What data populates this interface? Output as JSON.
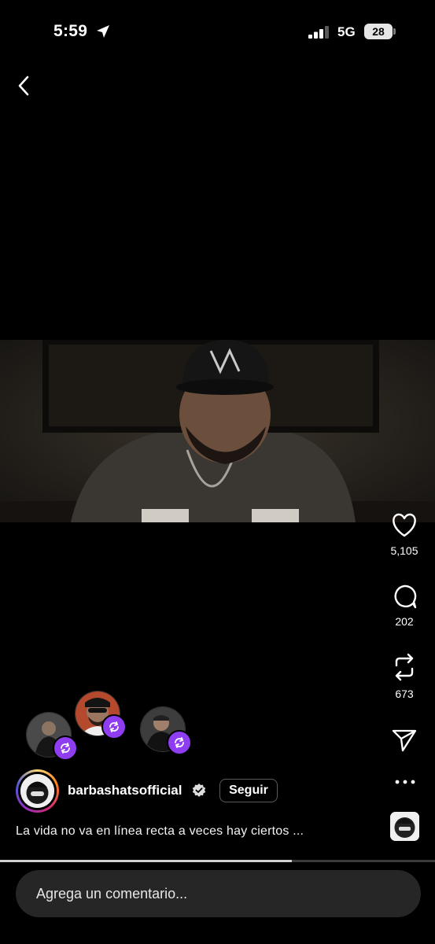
{
  "status_bar": {
    "time": "5:59",
    "network": "5G",
    "battery": "28"
  },
  "icons": {
    "back": "chevron-left-icon",
    "like": "heart-icon",
    "comment": "comment-bubble-icon",
    "repost": "repost-icon",
    "share": "send-icon",
    "more": "more-dots-icon",
    "verified": "verified-badge-icon"
  },
  "actions": {
    "likes": "5,105",
    "comments": "202",
    "reposts": "673"
  },
  "post": {
    "username": "barbashatsofficial",
    "follow_label": "Seguir",
    "caption": "La vida no va en línea recta a veces hay ciertos ..."
  },
  "progress": 0.67,
  "comment": {
    "placeholder": "Agrega un comentario..."
  },
  "colors": {
    "background": "#000000",
    "repost_badge": "#8f3df0",
    "comment_bar": "#262626"
  }
}
